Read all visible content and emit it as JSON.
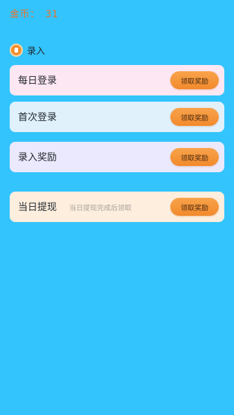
{
  "header": {
    "coins_label": "金币：",
    "coins_value": "31"
  },
  "section": {
    "title": "录入"
  },
  "tasks": [
    {
      "label": "每日登录",
      "button": "领取奖励"
    },
    {
      "label": "首次登录",
      "button": "领取奖励"
    },
    {
      "label": "录入奖励",
      "button": "领取奖励"
    },
    {
      "label": "当日提现",
      "hint": "当日提现完成后领取",
      "button": "领取奖励"
    }
  ],
  "colors": {
    "background": "#33c4fd",
    "accent": "#f28a2c",
    "coins_text": "#e8712a"
  }
}
